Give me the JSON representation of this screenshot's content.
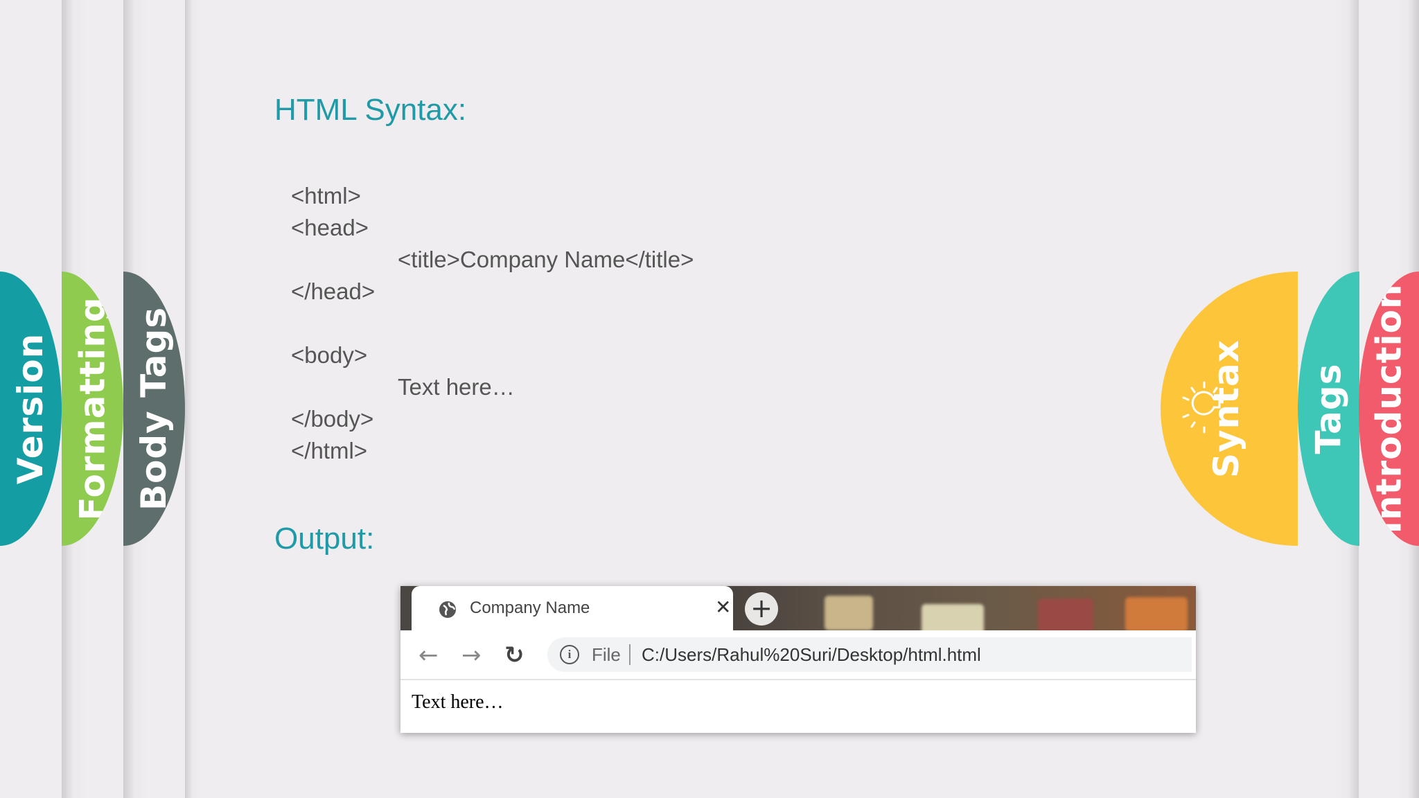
{
  "left_tabs": [
    {
      "label": "Version",
      "color": "#149ea3"
    },
    {
      "label": "Formatting",
      "color": "#8fcb4e"
    },
    {
      "label": "Body Tags",
      "color": "#5e6e6c"
    }
  ],
  "right_tabs": [
    {
      "label": "Syntax",
      "color": "#fdc53a",
      "icon": "lightbulb-icon"
    },
    {
      "label": "Tags",
      "color": "#3ec7b6"
    },
    {
      "label": "Introduction",
      "color": "#f25b6b"
    }
  ],
  "main": {
    "syntax_heading": "HTML Syntax:",
    "code_lines": [
      "<html>",
      "<head>",
      "<title>Company Name</title>",
      "</head>",
      "<body>",
      "Text here…",
      "</body>",
      "</html>"
    ],
    "output_heading": "Output:"
  },
  "browser": {
    "tab_title": "Company Name",
    "tab_icon": "globe-icon",
    "close_symbol": "✕",
    "new_tab_symbol": "+",
    "back_symbol": "←",
    "forward_symbol": "→",
    "reload_symbol": "↻",
    "info_symbol": "i",
    "scheme_label": "File",
    "url": "C:/Users/Rahul%20Suri/Desktop/html.html",
    "page_text": "Text here…"
  }
}
